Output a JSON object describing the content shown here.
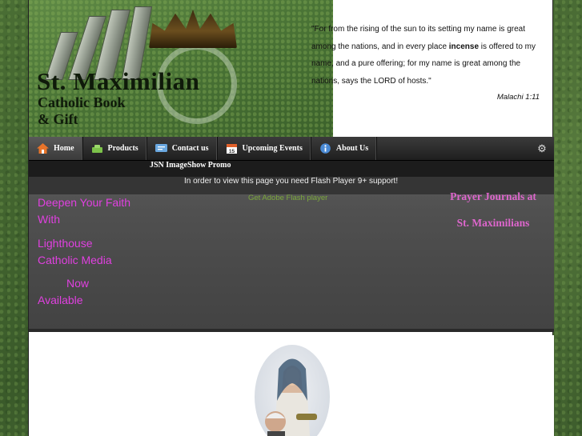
{
  "header": {
    "logo_line1": "St. Maximilian",
    "logo_line2": "Catholic Book",
    "logo_line3": "& Gift",
    "quote_part1": "\"For from the rising of the sun to its setting my name is great among the nations, and in every place ",
    "quote_bold": "incense",
    "quote_part2": " is offered to my name, and a pure offering; for my name is great among the nations, says the LORD of hosts.\"",
    "quote_reference": "Malachi 1:11"
  },
  "nav": {
    "items": [
      {
        "label": "Home",
        "icon": "home-icon"
      },
      {
        "label": "Products",
        "icon": "products-icon"
      },
      {
        "label": "Contact us",
        "icon": "contact-icon"
      },
      {
        "label": "Upcoming Events",
        "icon": "calendar-icon"
      },
      {
        "label": "About Us",
        "icon": "info-icon"
      }
    ],
    "settings_icon": "gear-icon"
  },
  "banner": {
    "promo_title": "JSN ImageShow Promo",
    "flash_message": "In order to view this page you need Flash Player 9+ support!",
    "flash_link": "Get Adobe Flash player",
    "deepen_lines": [
      "Deepen Your Faith",
      "With",
      "Lighthouse",
      "Catholic Media",
      "Now",
      "Available"
    ],
    "journals_lines": [
      "Prayer Journals at",
      "St. Maximilians"
    ]
  },
  "colors": {
    "background_green": "#4a6e34",
    "nav_dark": "#262626",
    "magenta_text": "#e040e0",
    "pink_serif": "#dd66cc",
    "flash_link_green": "#7ba83c"
  }
}
